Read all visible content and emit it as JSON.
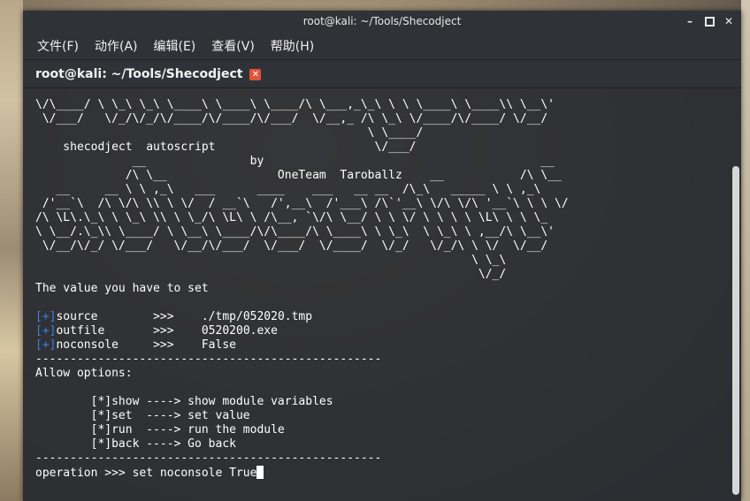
{
  "window": {
    "title": "root@kali: ~/Tools/Shecodject",
    "buttons": {
      "minimize": "–",
      "close": "✕"
    }
  },
  "menu": [
    "文件(F)",
    "动作(A)",
    "编辑(E)",
    "查看(V)",
    "帮助(H)"
  ],
  "tab": {
    "label": "root@kali: ~/Tools/Shecodject",
    "close_icon": "✕"
  },
  "terminal": {
    "banner_lines": [
      "\\/\\____/ \\ \\_\\ \\_\\ \\____\\ \\____\\ \\____/\\ \\___,_\\_\\ \\ \\ \\____\\ \\____\\\\ \\__\\'",
      " \\/___/   \\/_/\\/_/\\/____/\\/____/\\/___/  \\/__,_ /\\ \\_\\ \\/____/\\/____/ \\/__/",
      "                                                \\ \\____/",
      "    shecodject  autoscript                       \\/___/",
      "              __               by                                        __",
      "             /\\ \\__                OneTeam  Taroballz    __           /\\ \\__",
      "   __     __ \\ \\ ,_\\   ___      ____    ___   __ __  /\\_\\   _____ \\ \\ ,_\\",
      " /'__`\\  /\\ \\/\\ \\\\ \\ \\/  / __`\\   /',__\\  /'___\\ /\\`'__\\ \\/\\ \\/\\ '__`\\ \\ \\ \\/",
      "/\\ \\L\\.\\_\\ \\ \\_\\ \\\\ \\ \\_/\\ \\L\\ \\ /\\__, `\\/\\ \\__/ \\ \\ \\/ \\ \\ \\ \\ \\L\\ \\ \\ \\_",
      "\\ \\__/.\\_\\\\ \\____/ \\ \\__\\ \\____/\\/\\____/\\ \\____\\ \\ \\_\\  \\ \\_\\ \\ ,__/\\ \\__\\'",
      " \\/__/\\/_/ \\/___/   \\/__/\\/___/  \\/___/  \\/____/  \\/_/   \\/_/\\ \\ \\/  \\/__/",
      "                                                               \\ \\_\\",
      "                                                                \\/_/"
    ],
    "heading": "The value you have to set",
    "settings": [
      {
        "prefix": "[+]",
        "name": "source        ",
        "arrow": ">>>",
        "value": "./tmp/052020.tmp"
      },
      {
        "prefix": "[+]",
        "name": "outfile       ",
        "arrow": ">>>",
        "value": "0520200.exe"
      },
      {
        "prefix": "[+]",
        "name": "noconsole     ",
        "arrow": ">>>",
        "value": "False"
      }
    ],
    "separator": "--------------------------------------------------",
    "allow_label": "Allow options:",
    "options": [
      "        [*]show ----> show module variables",
      "        [*]set  ----> set value",
      "        [*]run  ----> run the module",
      "        [*]back ----> Go back"
    ],
    "prompt": "operation >>> ",
    "input_value": "set noconsole True"
  }
}
